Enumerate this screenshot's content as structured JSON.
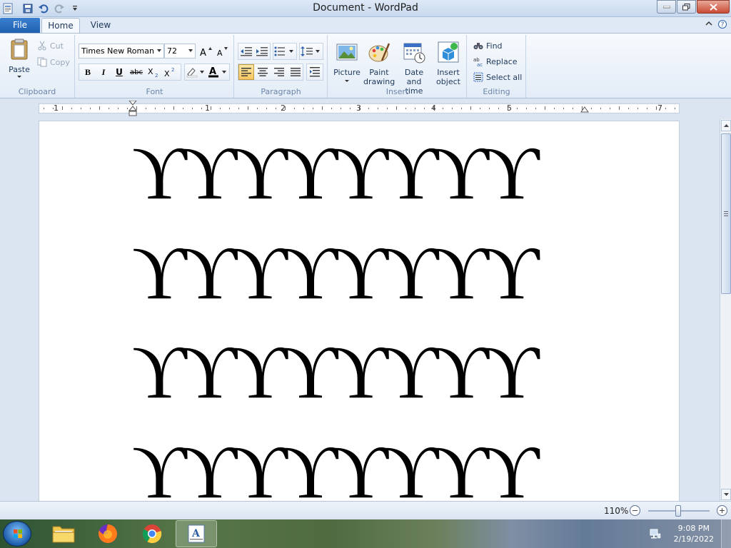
{
  "window": {
    "title": "Document - WordPad"
  },
  "tabs": {
    "file": "File",
    "home": "Home",
    "view": "View"
  },
  "clipboard": {
    "paste": "Paste",
    "cut": "Cut",
    "copy": "Copy",
    "group_label": "Clipboard"
  },
  "font": {
    "family": "Times New Roman",
    "size": "72",
    "group_label": "Font"
  },
  "paragraph": {
    "group_label": "Paragraph"
  },
  "insert": {
    "picture": "Picture",
    "paint_drawing": "Paint drawing",
    "date_time": "Date and time",
    "insert_object": "Insert object",
    "group_label": "Insert"
  },
  "editing": {
    "find": "Find",
    "replace": "Replace",
    "select_all": "Select all",
    "group_label": "Editing"
  },
  "ruler": {
    "labels": [
      "1",
      "1",
      "2",
      "3",
      "4",
      "5",
      "7"
    ]
  },
  "document": {
    "lines": [
      "ϒϒϒϒϒϒϒϒ",
      "ϒϒϒϒϒϒϒϒ",
      "ϒϒϒϒϒϒϒϒ",
      "ϒϒϒϒϒϒϒϒ"
    ]
  },
  "status": {
    "zoom": "110%",
    "zoom_level_percent": 110
  },
  "taskbar": {
    "time": "9:08 PM",
    "date": "2/19/2022",
    "apps": [
      "file-explorer",
      "firefox",
      "chrome",
      "wordpad"
    ]
  },
  "colors": {
    "file_tab": "#2a6cc0",
    "active_format": "#f8c660"
  }
}
